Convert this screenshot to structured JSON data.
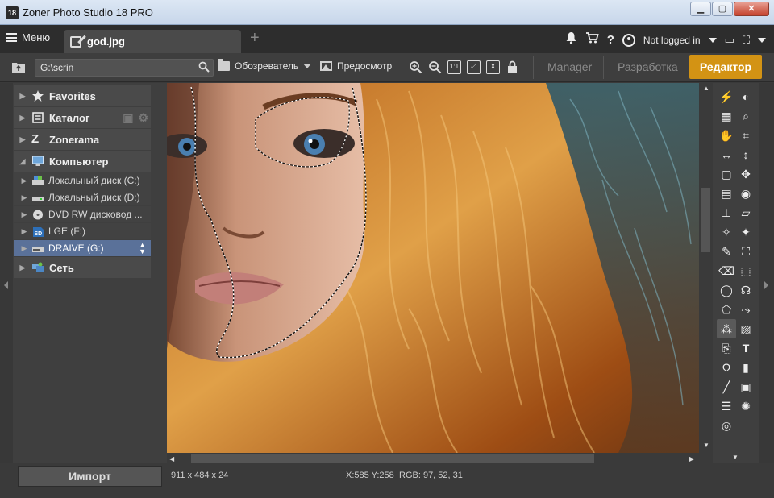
{
  "window": {
    "app_icon_label": "18",
    "title": "Zoner Photo Studio 18 PRO",
    "minimize": "▁",
    "maximize": "▢",
    "close": "✕"
  },
  "tabbar": {
    "menu_label": "Меню",
    "document_tab": "god.jpg",
    "add_tab": "+",
    "user_status": "Not logged in"
  },
  "toolbar": {
    "path": "G:\\scrin",
    "browser_label": "Обозреватель",
    "preview_label": "Предосмотр",
    "modes": {
      "manager": "Manager",
      "develop": "Разработка",
      "editor": "Редактор"
    }
  },
  "navigator": {
    "items": [
      {
        "label": "Favorites",
        "icon": "star-icon"
      },
      {
        "label": "Каталог",
        "icon": "catalog-icon"
      },
      {
        "label": "Zonerama",
        "icon": "zonerama-icon"
      },
      {
        "label": "Компьютер",
        "icon": "computer-icon"
      }
    ],
    "drives": [
      {
        "label": "Локальный диск (C:)",
        "icon": "drive-icon"
      },
      {
        "label": "Локальный диск (D:)",
        "icon": "drive-icon"
      },
      {
        "label": "DVD RW дисковод ...",
        "icon": "dvd-icon"
      },
      {
        "label": "LGE (F:)",
        "icon": "sd-card-icon"
      },
      {
        "label": "DRAIVE (G:)",
        "icon": "usb-drive-icon"
      }
    ],
    "network": {
      "label": "Сеть",
      "icon": "network-icon"
    },
    "import_label": "Импорт"
  },
  "status": {
    "dimensions": "911 x 484 x 24",
    "position": "X:585 Y:258",
    "rgb": "RGB: 97, 52, 31"
  },
  "colors": {
    "accent": "#d39314",
    "selection": "#5a7199",
    "panel": "#3f3f3f"
  }
}
